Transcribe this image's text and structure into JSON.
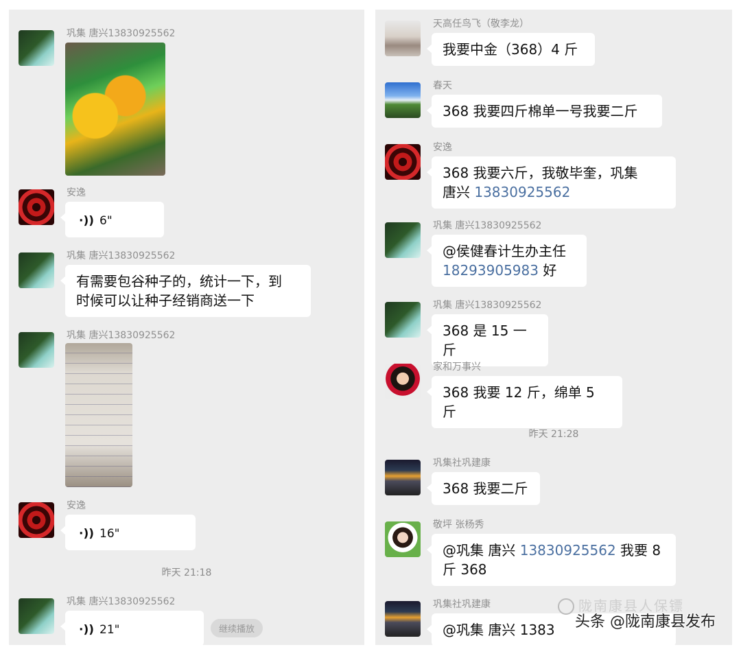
{
  "left_panel": {
    "messages": [
      {
        "sender": "巩集  唐兴13830925562",
        "type": "image",
        "image": "corn-seed-package"
      },
      {
        "sender": "安逸",
        "type": "voice",
        "duration": "6\""
      },
      {
        "sender": "巩集  唐兴13830925562",
        "type": "text",
        "text_lines": [
          "有需要包谷种子的，统计一下，到",
          "时候可以让种子经销商送一下"
        ]
      },
      {
        "sender": "巩集  唐兴13830925562",
        "type": "image",
        "image": "handwritten-list"
      },
      {
        "sender": "安逸",
        "type": "voice",
        "duration": "16\""
      },
      {
        "sender": "巩集  唐兴13830925562",
        "type": "voice",
        "duration": "21\"",
        "resume_label": "继续播放"
      }
    ],
    "timestamp": "昨天 21:18"
  },
  "right_panel": {
    "messages": [
      {
        "sender": "天高任鸟飞（敬李龙）",
        "text": "我要中金（368）4 斤"
      },
      {
        "sender": "春天",
        "text": "368 我要四斤棉单一号我要二斤"
      },
      {
        "sender": "安逸",
        "text_lines": [
          "368  我要六斤，我敬毕奎，巩集",
          "唐兴 "
        ],
        "link": "13830925562"
      },
      {
        "sender": "巩集  唐兴13830925562",
        "text_lines": [
          "@侯健春计生办主任",
          " 好"
        ],
        "link": "18293905983"
      },
      {
        "sender": "巩集  唐兴13830925562",
        "text": "368 是 15 一斤"
      },
      {
        "sender": "家和万事兴",
        "text": "368 我要 12 斤，绵单 5 斤"
      },
      {
        "sender": "巩集社巩建康",
        "text": "368 我要二斤"
      },
      {
        "sender": "敬坪 张杨秀",
        "text_lines": [
          "@巩集  唐兴 ",
          " 我要 8",
          "斤 368"
        ],
        "link": "13830925562"
      },
      {
        "sender": "巩集社巩建康",
        "text": "@巩集  唐兴 1383"
      }
    ],
    "timestamp": "昨天 21:28"
  },
  "watermark": {
    "text": "头条 @陇南康县发布",
    "faint_text": "陇南康县人保镖"
  },
  "colors": {
    "panel_bg": "#ededed",
    "bubble_bg": "#ffffff",
    "link": "#4a6fa0",
    "meta_text": "#8f8f8f"
  },
  "icons": {
    "voice": "voice-wave-icon"
  }
}
